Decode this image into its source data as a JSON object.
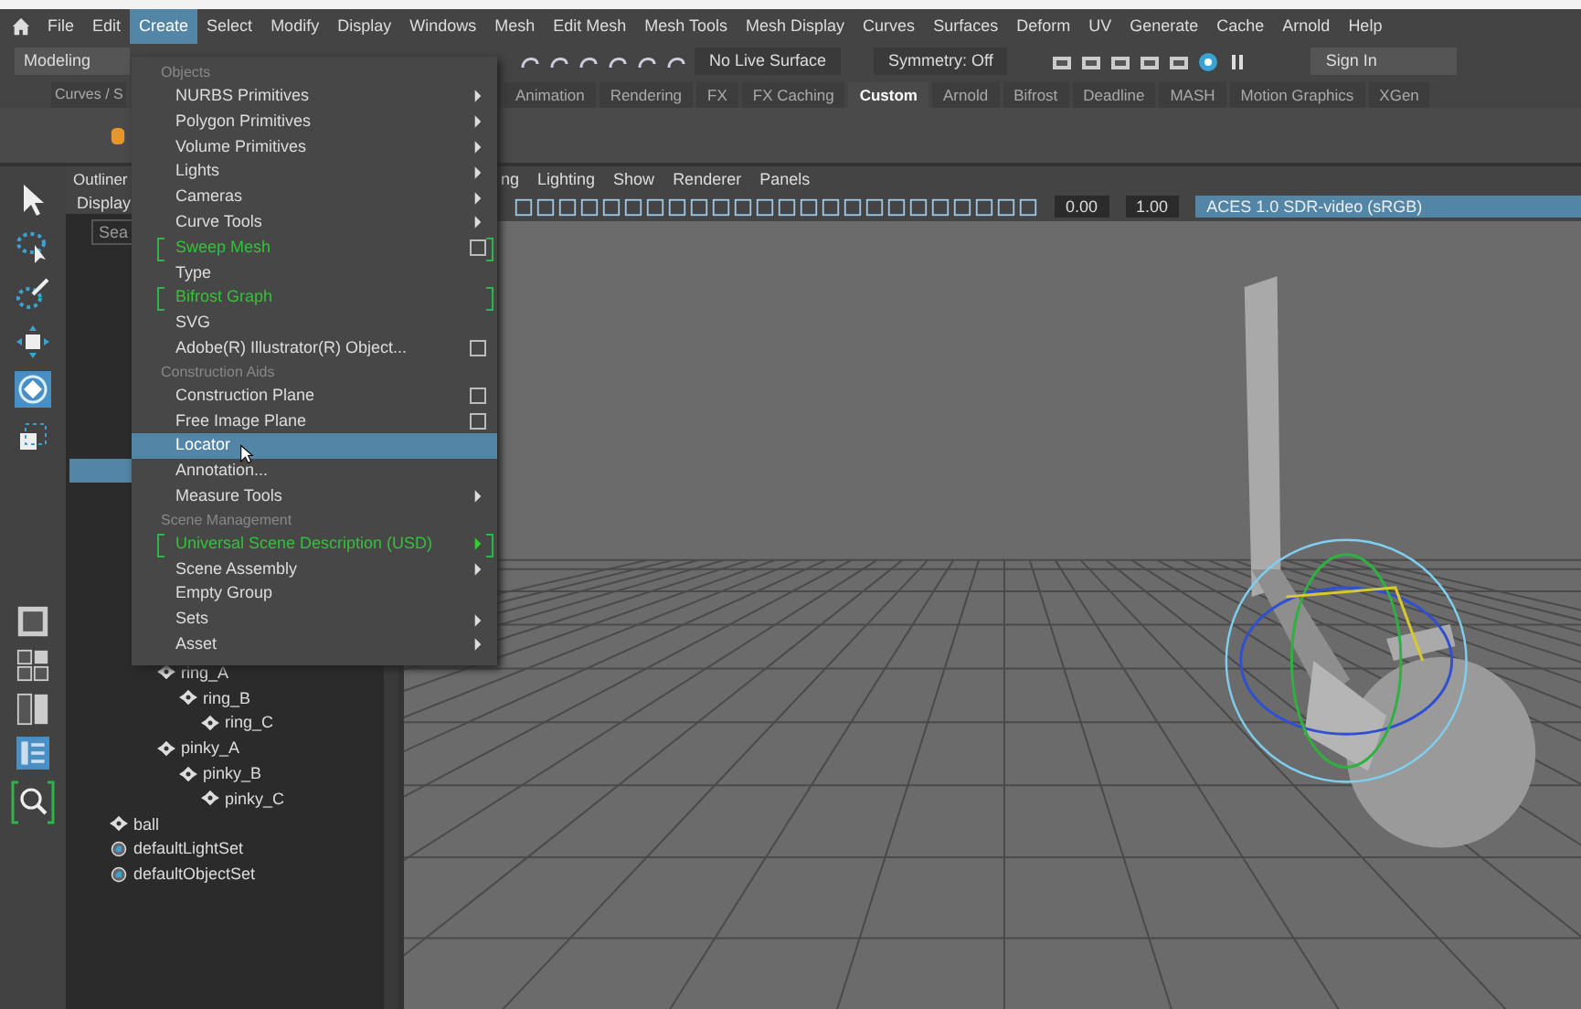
{
  "menu_bar": [
    {
      "label": "File",
      "selected": false
    },
    {
      "label": "Edit",
      "selected": false
    },
    {
      "label": "Create",
      "selected": true
    },
    {
      "label": "Select",
      "selected": false
    },
    {
      "label": "Modify",
      "selected": false
    },
    {
      "label": "Display",
      "selected": false
    },
    {
      "label": "Windows",
      "selected": false
    },
    {
      "label": "Mesh",
      "selected": false
    },
    {
      "label": "Edit Mesh",
      "selected": false
    },
    {
      "label": "Mesh Tools",
      "selected": false
    },
    {
      "label": "Mesh Display",
      "selected": false
    },
    {
      "label": "Curves",
      "selected": false
    },
    {
      "label": "Surfaces",
      "selected": false
    },
    {
      "label": "Deform",
      "selected": false
    },
    {
      "label": "UV",
      "selected": false
    },
    {
      "label": "Generate",
      "selected": false
    },
    {
      "label": "Cache",
      "selected": false
    },
    {
      "label": "Arnold",
      "selected": false
    },
    {
      "label": "Help",
      "selected": false
    }
  ],
  "status_line": {
    "mode": "Modeling",
    "live_surface": "No Live Surface",
    "symmetry": "Symmetry: Off",
    "sign_in": "Sign In"
  },
  "shelf_tabs": [
    {
      "label": "Curves / S",
      "selected": false
    },
    {
      "label": "Animation",
      "selected": false
    },
    {
      "label": "Rendering",
      "selected": false
    },
    {
      "label": "FX",
      "selected": false
    },
    {
      "label": "FX Caching",
      "selected": false
    },
    {
      "label": "Custom",
      "selected": true
    },
    {
      "label": "Arnold",
      "selected": false
    },
    {
      "label": "Bifrost",
      "selected": false
    },
    {
      "label": "Deadline",
      "selected": false
    },
    {
      "label": "MASH",
      "selected": false
    },
    {
      "label": "Motion Graphics",
      "selected": false
    },
    {
      "label": "XGen",
      "selected": false
    }
  ],
  "create_menu": [
    {
      "kind": "header",
      "label": "Objects"
    },
    {
      "kind": "item",
      "label": "NURBS Primitives",
      "submenu": true,
      "option_box": false,
      "selected": false
    },
    {
      "kind": "item",
      "label": "Polygon Primitives",
      "submenu": true,
      "option_box": false,
      "selected": false
    },
    {
      "kind": "item",
      "label": "Volume Primitives",
      "submenu": true,
      "option_box": false,
      "selected": false
    },
    {
      "kind": "item",
      "label": "Lights",
      "submenu": true,
      "option_box": false,
      "selected": false
    },
    {
      "kind": "item",
      "label": "Cameras",
      "submenu": true,
      "option_box": false,
      "selected": false
    },
    {
      "kind": "item",
      "label": "Curve Tools",
      "submenu": true,
      "option_box": false,
      "selected": false
    },
    {
      "kind": "plugin",
      "label": "Sweep Mesh",
      "submenu": false,
      "option_box": true,
      "selected": false
    },
    {
      "kind": "item",
      "label": "Type",
      "submenu": false,
      "option_box": false,
      "selected": false
    },
    {
      "kind": "plugin",
      "label": "Bifrost Graph",
      "submenu": false,
      "option_box": false,
      "selected": false
    },
    {
      "kind": "item",
      "label": "SVG",
      "submenu": false,
      "option_box": false,
      "selected": false
    },
    {
      "kind": "item",
      "label": "Adobe(R) Illustrator(R) Object...",
      "submenu": false,
      "option_box": true,
      "selected": false
    },
    {
      "kind": "header",
      "label": "Construction Aids"
    },
    {
      "kind": "item",
      "label": "Construction Plane",
      "submenu": false,
      "option_box": true,
      "selected": false
    },
    {
      "kind": "item",
      "label": "Free Image Plane",
      "submenu": false,
      "option_box": true,
      "selected": false
    },
    {
      "kind": "item",
      "label": "Locator",
      "submenu": false,
      "option_box": false,
      "selected": true
    },
    {
      "kind": "item",
      "label": "Annotation...",
      "submenu": false,
      "option_box": false,
      "selected": false
    },
    {
      "kind": "item",
      "label": "Measure Tools",
      "submenu": true,
      "option_box": false,
      "selected": false
    },
    {
      "kind": "header",
      "label": "Scene Management"
    },
    {
      "kind": "plugin",
      "label": "Universal Scene Description (USD)",
      "submenu": true,
      "option_box": false,
      "selected": false
    },
    {
      "kind": "item",
      "label": "Scene Assembly",
      "submenu": true,
      "option_box": false,
      "selected": false
    },
    {
      "kind": "item",
      "label": "Empty Group",
      "submenu": false,
      "option_box": false,
      "selected": false
    },
    {
      "kind": "item",
      "label": "Sets",
      "submenu": true,
      "option_box": false,
      "selected": false
    },
    {
      "kind": "item",
      "label": "Asset",
      "submenu": true,
      "option_box": false,
      "selected": false
    }
  ],
  "outliner": {
    "title": "Outliner",
    "menu": "Display",
    "search_placeholder": "Sea",
    "joint_chains": [
      {
        "label": "ring_A",
        "kind": "joint",
        "children": [
          {
            "label": "ring_B",
            "kind": "joint",
            "children": [
              {
                "label": "ring_C",
                "kind": "joint"
              }
            ]
          }
        ]
      },
      {
        "label": "pinky_A",
        "kind": "joint",
        "children": [
          {
            "label": "pinky_B",
            "kind": "joint",
            "children": [
              {
                "label": "pinky_C",
                "kind": "joint"
              }
            ]
          }
        ]
      }
    ],
    "root_items": [
      {
        "label": "ball",
        "kind": "joint"
      },
      {
        "label": "defaultLightSet",
        "kind": "set"
      },
      {
        "label": "defaultObjectSet",
        "kind": "set"
      }
    ]
  },
  "viewport": {
    "menus": [
      "ng",
      "Lighting",
      "Show",
      "Renderer",
      "Panels"
    ],
    "exposure": "0.00",
    "gamma": "1.00",
    "color_space": "ACES 1.0 SDR-video (sRGB)"
  }
}
